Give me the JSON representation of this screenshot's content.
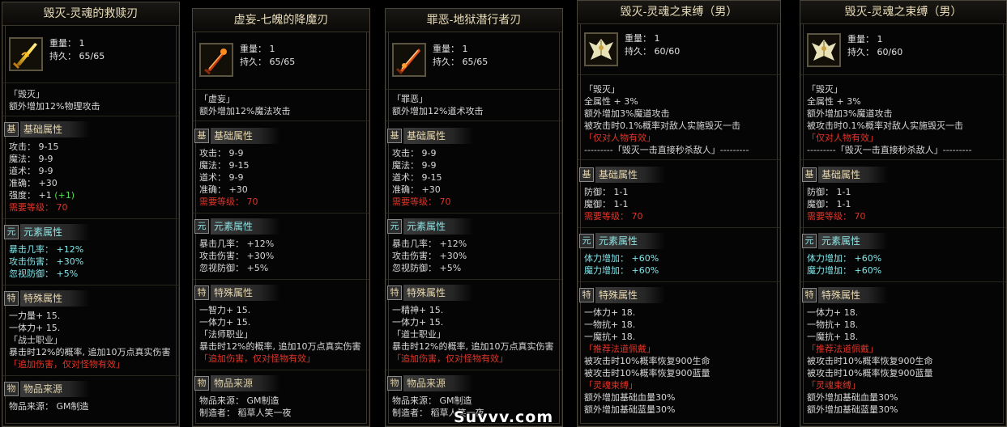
{
  "labels": {
    "weight": "重量： 1",
    "base_badge": "基",
    "base_title": "基础属性",
    "elem_badge": "元",
    "elem_title": "元素属性",
    "spec_badge": "特",
    "spec_title": "特殊属性",
    "src_badge": "物",
    "src_title": "物品来源"
  },
  "watermark": "Suvvv.com",
  "items": [
    {
      "name": "毁灭-灵魂的救赎刃",
      "icon": "golden-blade-icon",
      "durability": "持久： 65/65",
      "affix_name": "「毁灭」",
      "affix_line": "额外增加12%物理攻击",
      "base": [
        "攻击： 9-15",
        "魔法： 9-9",
        "道术： 9-9",
        "准确： +30"
      ],
      "strength": "强度： +1",
      "strength_bonus": "(+1)",
      "req_level": "需要等级： 70",
      "elem": [
        "暴击几率： +12%",
        "攻击伤害： +30%",
        "忽视防御： +5%"
      ],
      "special": [
        "一力量+ 15.",
        "一体力+ 15."
      ],
      "job": "「战士职业」",
      "crit_effect": "暴击时12%的概率, 追加10万点真实伤害",
      "crit_note": "「追加伤害，仅对怪物有效」",
      "source": "物品来源： GM制造"
    },
    {
      "name": "虚妄-七魄的降魔刃",
      "icon": "flame-blade-icon",
      "durability": "持久： 65/65",
      "affix_name": "「虚妄」",
      "affix_line": "额外增加12%魔法攻击",
      "base": [
        "攻击： 9-9",
        "魔法： 9-15",
        "道术： 9-9",
        "准确： +30"
      ],
      "req_level": "需要等级： 70",
      "elem": [
        "暴击几率： +12%",
        "攻击伤害： +30%",
        "忽视防御： +5%"
      ],
      "special": [
        "一智力+ 15.",
        "一体力+ 15."
      ],
      "job": "「法师职业」",
      "crit_effect": "暴击时12%的概率, 追加10万点真实伤害",
      "crit_note": "「追加伤害，仅对怪物有效」",
      "source": "物品来源： GM制造",
      "source2": "制造者： 稻草人笑一夜"
    },
    {
      "name": "罪恶-地狱潜行者刃",
      "icon": "fire-blade-icon",
      "durability": "持久： 65/65",
      "affix_name": "「罪恶」",
      "affix_line": "额外增加12%道术攻击",
      "base": [
        "攻击： 9-9",
        "魔法： 9-9",
        "道术： 9-15",
        "准确： +30"
      ],
      "req_level": "需要等级： 70",
      "elem": [
        "暴击几率： +12%",
        "攻击伤害： +30%",
        "忽视防御： +5%"
      ],
      "special": [
        "一精神+ 15.",
        "一体力+ 15."
      ],
      "job": "「道士职业」",
      "crit_effect": "暴击时12%的概率, 追加10万点真实伤害",
      "crit_note": "「追加伤害，仅对怪物有效」",
      "source": "物品来源： GM制造",
      "source2": "制造者： 稻草人笑一夜"
    },
    {
      "name": "毁灭-灵魂之束缚（男）",
      "icon": "winged-armor-icon",
      "durability": "持久： 60/60",
      "affix_name": "「毁灭」",
      "affix_lines": [
        "全属性 + 3%",
        "额外增加3%魔道攻击",
        "被攻击时0.1%概率对敌人实施毁灭一击"
      ],
      "affix_note": "「仅对人物有效」",
      "affix_rule": "---------「毁灭一击直接秒杀敌人」---------",
      "base": [
        "防御： 1-1",
        "魔御： 1-1"
      ],
      "req_level": "需要等级： 70",
      "elem": [
        "体力增加： +60%",
        "魔力增加： +60%"
      ],
      "special": [
        "一体力+ 18.",
        "一物抗+ 18.",
        "一魔抗+ 18."
      ],
      "job": "「推荐法道佩戴」",
      "extra": [
        "被攻击时10%概率恢复900生命",
        "被攻击时10%概率恢复900蓝量"
      ],
      "set_name": "「灵魂束缚」",
      "set_lines": [
        "额外增加基础血量30%",
        "额外增加基础蓝量30%"
      ]
    },
    {
      "name": "毁灭-灵魂之束缚（男）",
      "icon": "winged-armor-icon",
      "durability": "持久： 60/60",
      "affix_name": "「毁灭」",
      "affix_lines": [
        "全属性 + 3%",
        "额外增加3%魔道攻击",
        "被攻击时0.1%概率对敌人实施毁灭一击"
      ],
      "affix_note": "「仅对人物有效」",
      "affix_rule": "---------「毁灭一击直接秒杀敌人」---------",
      "base": [
        "防御： 1-1",
        "魔御： 1-1"
      ],
      "req_level": "需要等级： 70",
      "elem": [
        "体力增加： +60%",
        "魔力增加： +60%"
      ],
      "special": [
        "一体力+ 18.",
        "一物抗+ 18.",
        "一魔抗+ 18."
      ],
      "job": "「推荐法道佩戴」",
      "extra": [
        "被攻击时10%概率恢复900生命",
        "被攻击时10%概率恢复900蓝量"
      ],
      "set_name": "「灵魂束缚」",
      "set_lines": [
        "额外增加基础血量30%",
        "额外增加基础蓝量30%"
      ]
    }
  ]
}
